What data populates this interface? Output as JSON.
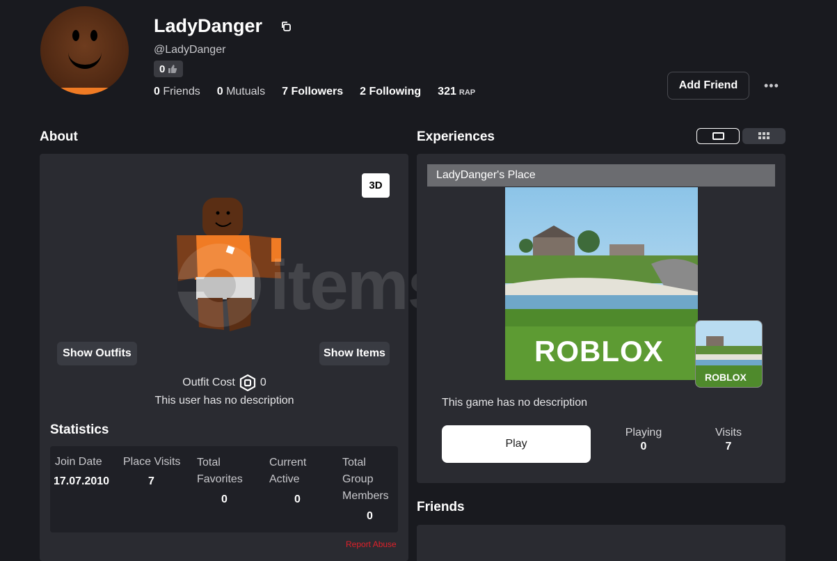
{
  "profile": {
    "display_name": "LadyDanger",
    "username": "@LadyDanger",
    "reputation": "0",
    "friends_count": "0",
    "friends_label": "Friends",
    "mutuals_count": "0",
    "mutuals_label": "Mutuals",
    "followers_count": "7",
    "followers_label": "Followers",
    "following_count": "2",
    "following_label": "Following",
    "rap_value": "321",
    "rap_label": "RAP",
    "add_friend_label": "Add Friend"
  },
  "about": {
    "title": "About",
    "view_3d_label": "3D",
    "show_outfits_label": "Show Outfits",
    "show_items_label": "Show Items",
    "outfit_cost_label": "Outfit Cost",
    "outfit_cost_value": "0",
    "description": "This user has no description"
  },
  "statistics": {
    "title": "Statistics",
    "join_date_label": "Join Date",
    "join_date_value": "17.07.2010",
    "place_visits_label": "Place Visits",
    "place_visits_value": "7",
    "total_favorites_label_1": "Total",
    "total_favorites_label_2": "Favorites",
    "total_favorites_value": "0",
    "current_active_label_1": "Current",
    "current_active_label_2": "Active",
    "current_active_value": "0",
    "group_members_label_1": "Total",
    "group_members_label_2": "Group",
    "group_members_label_3": "Members",
    "group_members_value": "0",
    "report_abuse_label": "Report Abuse"
  },
  "experiences": {
    "title": "Experiences",
    "place_name": "LadyDanger's Place",
    "thumbnail_logo": "ROBLOX",
    "icon_logo": "ROBLOX",
    "description": "This game has no description",
    "play_label": "Play",
    "playing_label": "Playing",
    "playing_value": "0",
    "visits_label": "Visits",
    "visits_value": "7"
  },
  "friends": {
    "title": "Friends"
  },
  "watermark": {
    "text": "items"
  },
  "colors": {
    "background": "#191a1f",
    "panel": "#2a2b31",
    "accent_orange": "#f07b24",
    "report_red": "#e0212a"
  }
}
